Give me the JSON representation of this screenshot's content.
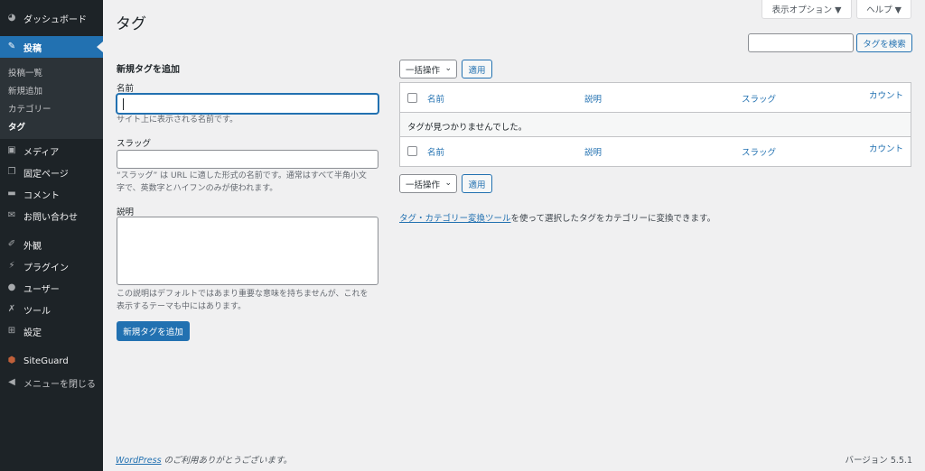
{
  "sidebar": {
    "items": [
      {
        "label": "ダッシュボード",
        "icon": "dashboard-icon"
      },
      {
        "label": "投稿",
        "icon": "pin-icon"
      },
      {
        "label": "メディア",
        "icon": "media-icon"
      },
      {
        "label": "固定ページ",
        "icon": "page-icon"
      },
      {
        "label": "コメント",
        "icon": "comment-icon"
      },
      {
        "label": "お問い合わせ",
        "icon": "mail-icon"
      },
      {
        "label": "外観",
        "icon": "appearance-icon"
      },
      {
        "label": "プラグイン",
        "icon": "plugin-icon"
      },
      {
        "label": "ユーザー",
        "icon": "user-icon"
      },
      {
        "label": "ツール",
        "icon": "wrench-icon"
      },
      {
        "label": "設定",
        "icon": "settings-icon"
      },
      {
        "label": "SiteGuard",
        "icon": "siteguard-icon"
      },
      {
        "label": "メニューを閉じる",
        "icon": "collapse-icon"
      }
    ],
    "submenu": [
      "投稿一覧",
      "新規追加",
      "カテゴリー",
      "タグ"
    ]
  },
  "screen_options": "表示オプション ▼",
  "help": "ヘルプ ▼",
  "page_title": "タグ",
  "search": {
    "button": "タグを検索",
    "value": ""
  },
  "form": {
    "heading": "新規タグを追加",
    "name_label": "名前",
    "name_help": "サイト上に表示される名前です。",
    "slug_label": "スラッグ",
    "slug_help_1": "“スラッグ” は URL に適した形式の名前です。通常はすべて半角小文",
    "slug_help_2": "字で、英数字とハイフンのみが使われます。",
    "desc_label": "説明",
    "desc_help_1": "この説明はデフォルトではあまり重要な意味を持ちませんが、これを",
    "desc_help_2": "表示するテーマも中にはあります。",
    "submit": "新規タグを追加"
  },
  "bulk": {
    "select": "一括操作",
    "apply": "適用"
  },
  "table": {
    "columns": [
      "名前",
      "説明",
      "スラッグ",
      "カウント"
    ],
    "empty": "タグが見つかりませんでした。"
  },
  "converter": {
    "link": "タグ・カテゴリー変換ツール",
    "text": "を使って選択したタグをカテゴリーに変換できます。"
  },
  "footer": {
    "link": "WordPress",
    "text": " のご利用ありがとうございます。",
    "version": "バージョン 5.5.1"
  }
}
